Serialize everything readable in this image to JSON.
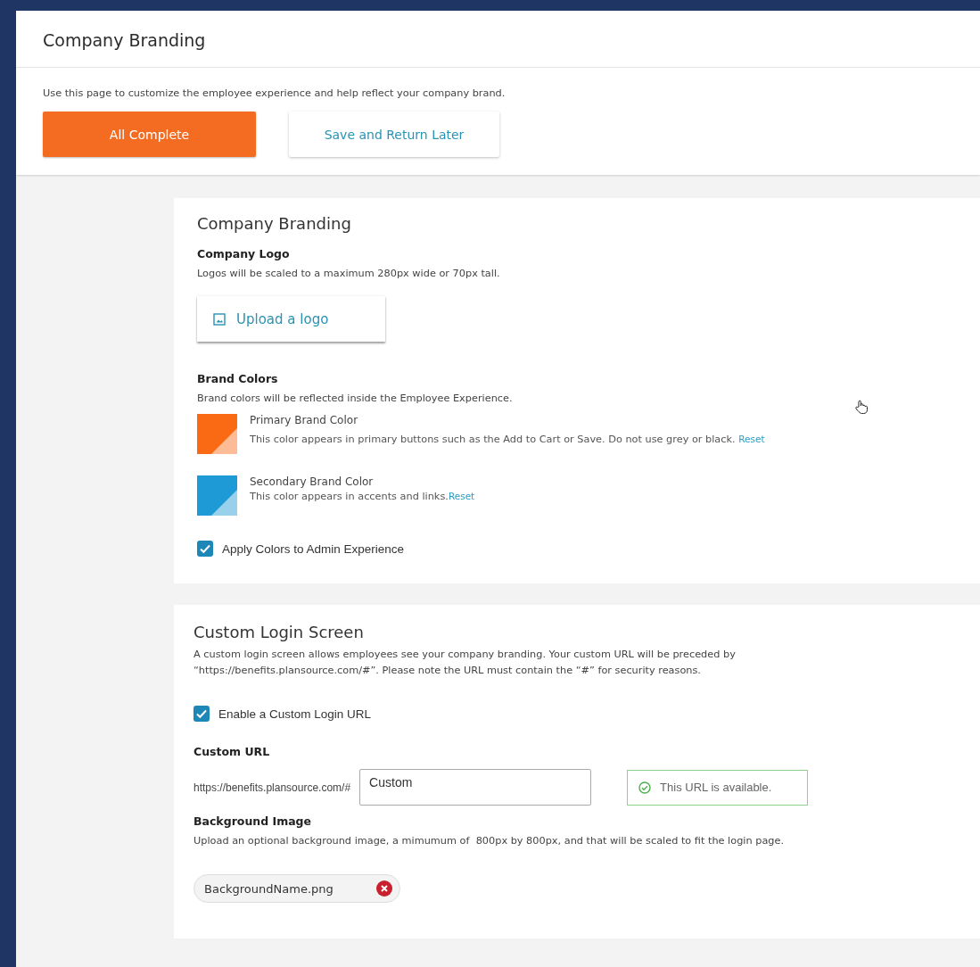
{
  "header": {
    "title": "Company Branding",
    "description": "Use this page to customize the employee experience and help reflect your company brand.",
    "buttons": [
      {
        "label": "All Complete",
        "kind": "primary"
      },
      {
        "label": "Save and Return Later",
        "kind": "secondary"
      }
    ]
  },
  "branding": {
    "title": "Company Branding",
    "logo": {
      "heading": "Company Logo",
      "note": "Logos will be scaled to a maximum 280px wide or 70px tall.",
      "upload_button": "Upload a logo"
    },
    "colors": {
      "heading": "Brand Colors",
      "note": "Brand colors will be reflected inside the Employee Experience.",
      "items": [
        {
          "name": "Primary Brand Color",
          "description": "This color appears in primary buttons such as the Add to Cart or Save. Do not use grey or black.",
          "reset": "Reset",
          "color": "#fa6a14"
        },
        {
          "name": "Secondary Brand Color",
          "description": "This color appears in accents and links.",
          "reset": "Reset",
          "color": "#1e9ad6"
        }
      ]
    },
    "apply_admin": {
      "label": "Apply Colors to Admin Experience",
      "checked": true
    }
  },
  "login": {
    "title": "Custom Login Screen",
    "description": "A custom login screen allows employees see your company branding. Your custom URL will be preceded by “https://benefits.plansource.com/#”. Please note the URL must contain the “#” for security reasons.",
    "enable": {
      "label": "Enable a Custom Login URL",
      "checked": true
    },
    "url": {
      "heading": "Custom URL",
      "prefix": "https://benefits.plansource.com/#",
      "value": "Custom",
      "status": "This URL is available."
    },
    "background": {
      "heading": "Background Image",
      "note": "Upload an optional background image, a mimumum of  800px by 800px, and that will be scaled to fit the login page.",
      "file": "BackgroundName.png"
    }
  }
}
